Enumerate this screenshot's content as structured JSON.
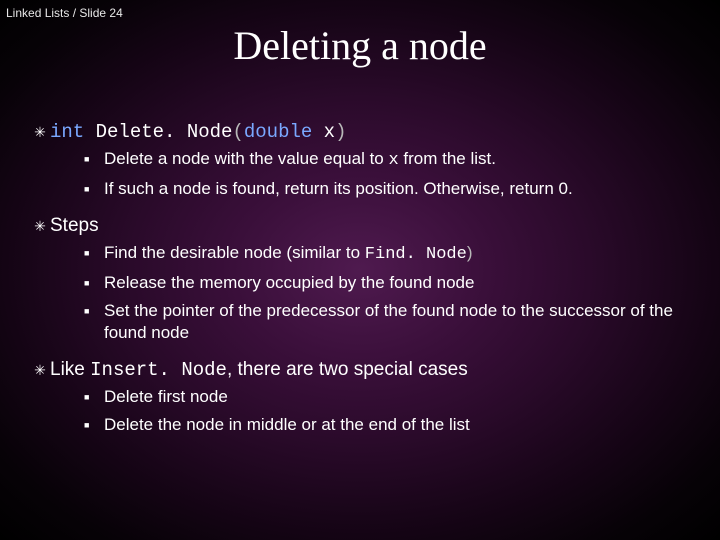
{
  "breadcrumb": "Linked Lists / Slide 24",
  "title": "Deleting a node",
  "section1": {
    "sig_pre": "int",
    "sig_name": " Delete. Node",
    "sig_open": "(",
    "sig_type": "double",
    "sig_arg": " x",
    "sig_close": ")",
    "b1_pre": "Delete a node with the value equal to ",
    "b1_code": "x",
    "b1_post": " from the list.",
    "b2": "If such a node is found, return its position. Otherwise, return 0."
  },
  "section2": {
    "heading": "Steps",
    "b1_pre": "Find the desirable node (similar to ",
    "b1_code": "Find. Node",
    "b1_post": ")",
    "b2": "Release the memory occupied by the found node",
    "b3": "Set the pointer of the predecessor of the found node to the successor of the found node"
  },
  "section3": {
    "heading_pre": "Like ",
    "heading_code": "Insert. Node",
    "heading_post": ", there are two special cases",
    "b1": "Delete first node",
    "b2": "Delete the node in middle or at the end of the list"
  }
}
